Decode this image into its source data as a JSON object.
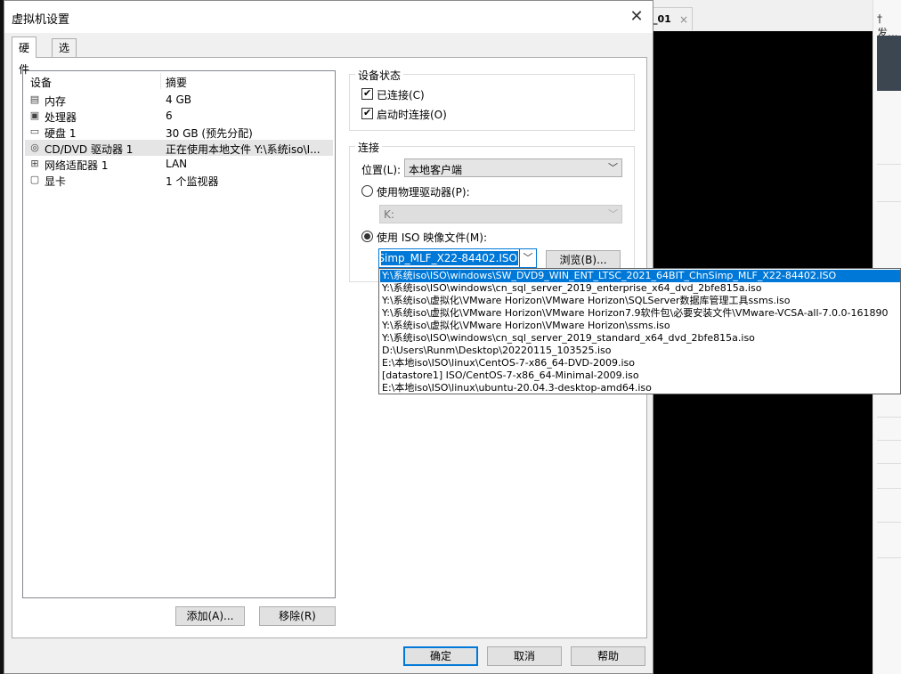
{
  "background": {
    "tab_label": "_01",
    "tab_close": "×",
    "right_fragment": "†发..."
  },
  "dialog": {
    "title": "虚拟机设置",
    "close_glyph": "✕",
    "tabs": [
      "硬件",
      "选项"
    ]
  },
  "device_list": {
    "headers": {
      "device": "设备",
      "summary": "摘要"
    },
    "rows": [
      {
        "icon": "memory-icon",
        "name": "内存",
        "value": "4 GB"
      },
      {
        "icon": "processor-icon",
        "name": "处理器",
        "value": "6"
      },
      {
        "icon": "hard-disk-icon",
        "name": "硬盘 1",
        "value": "30 GB (预先分配)"
      },
      {
        "icon": "cd-dvd-icon",
        "name": "CD/DVD 驱动器 1",
        "value": "正在使用本地文件 Y:\\系统iso\\I..."
      },
      {
        "icon": "network-adapter-icon",
        "name": "网络适配器 1",
        "value": "LAN"
      },
      {
        "icon": "display-icon",
        "name": "显卡",
        "value": "1 个监视器"
      }
    ],
    "selected_index": 3,
    "add_button": "添加(A)...",
    "remove_button": "移除(R)"
  },
  "device_status": {
    "legend": "设备状态",
    "connected_label": "已连接(C)",
    "connected_checked": true,
    "connect_on_power_label": "启动时连接(O)",
    "connect_on_power_checked": true
  },
  "connection": {
    "legend": "连接",
    "location_label": "位置(L):",
    "location_value": "本地客户端",
    "physical_label": "使用物理驱动器(P):",
    "physical_value": "K:",
    "iso_label": "使用 ISO 映像文件(M):",
    "iso_value": "Y:\\系统iso\\ISO\\windows\\SW_DVD9_WIN_ENT_LTSC_2021_64BIT_ChnSimp_MLF_X22-84402.ISO",
    "browse_button": "浏览(B)...",
    "dropdown_options": [
      "Y:\\系统iso\\ISO\\windows\\SW_DVD9_WIN_ENT_LTSC_2021_64BIT_ChnSimp_MLF_X22-84402.ISO",
      "Y:\\系统iso\\ISO\\windows\\cn_sql_server_2019_enterprise_x64_dvd_2bfe815a.iso",
      "Y:\\系统iso\\虚拟化\\VMware Horizon\\VMware Horizon\\SQLServer数据库管理工具ssms.iso",
      "Y:\\系统iso\\虚拟化\\VMware Horizon\\VMware Horizon7.9软件包\\必要安装文件\\VMware-VCSA-all-7.0.0-161890",
      "Y:\\系统iso\\虚拟化\\VMware Horizon\\VMware Horizon\\ssms.iso",
      "Y:\\系统iso\\ISO\\windows\\cn_sql_server_2019_standard_x64_dvd_2bfe815a.iso",
      "D:\\Users\\Runm\\Desktop\\20220115_103525.iso",
      "E:\\本地iso\\ISO\\linux\\CentOS-7-x86_64-DVD-2009.iso",
      "[datastore1] ISO/CentOS-7-x86_64-Minimal-2009.iso",
      "E:\\本地iso\\ISO\\linux\\ubuntu-20.04.3-desktop-amd64.iso"
    ],
    "highlighted_index": 0
  },
  "footer": {
    "ok": "确定",
    "cancel": "取消",
    "help": "帮助"
  }
}
